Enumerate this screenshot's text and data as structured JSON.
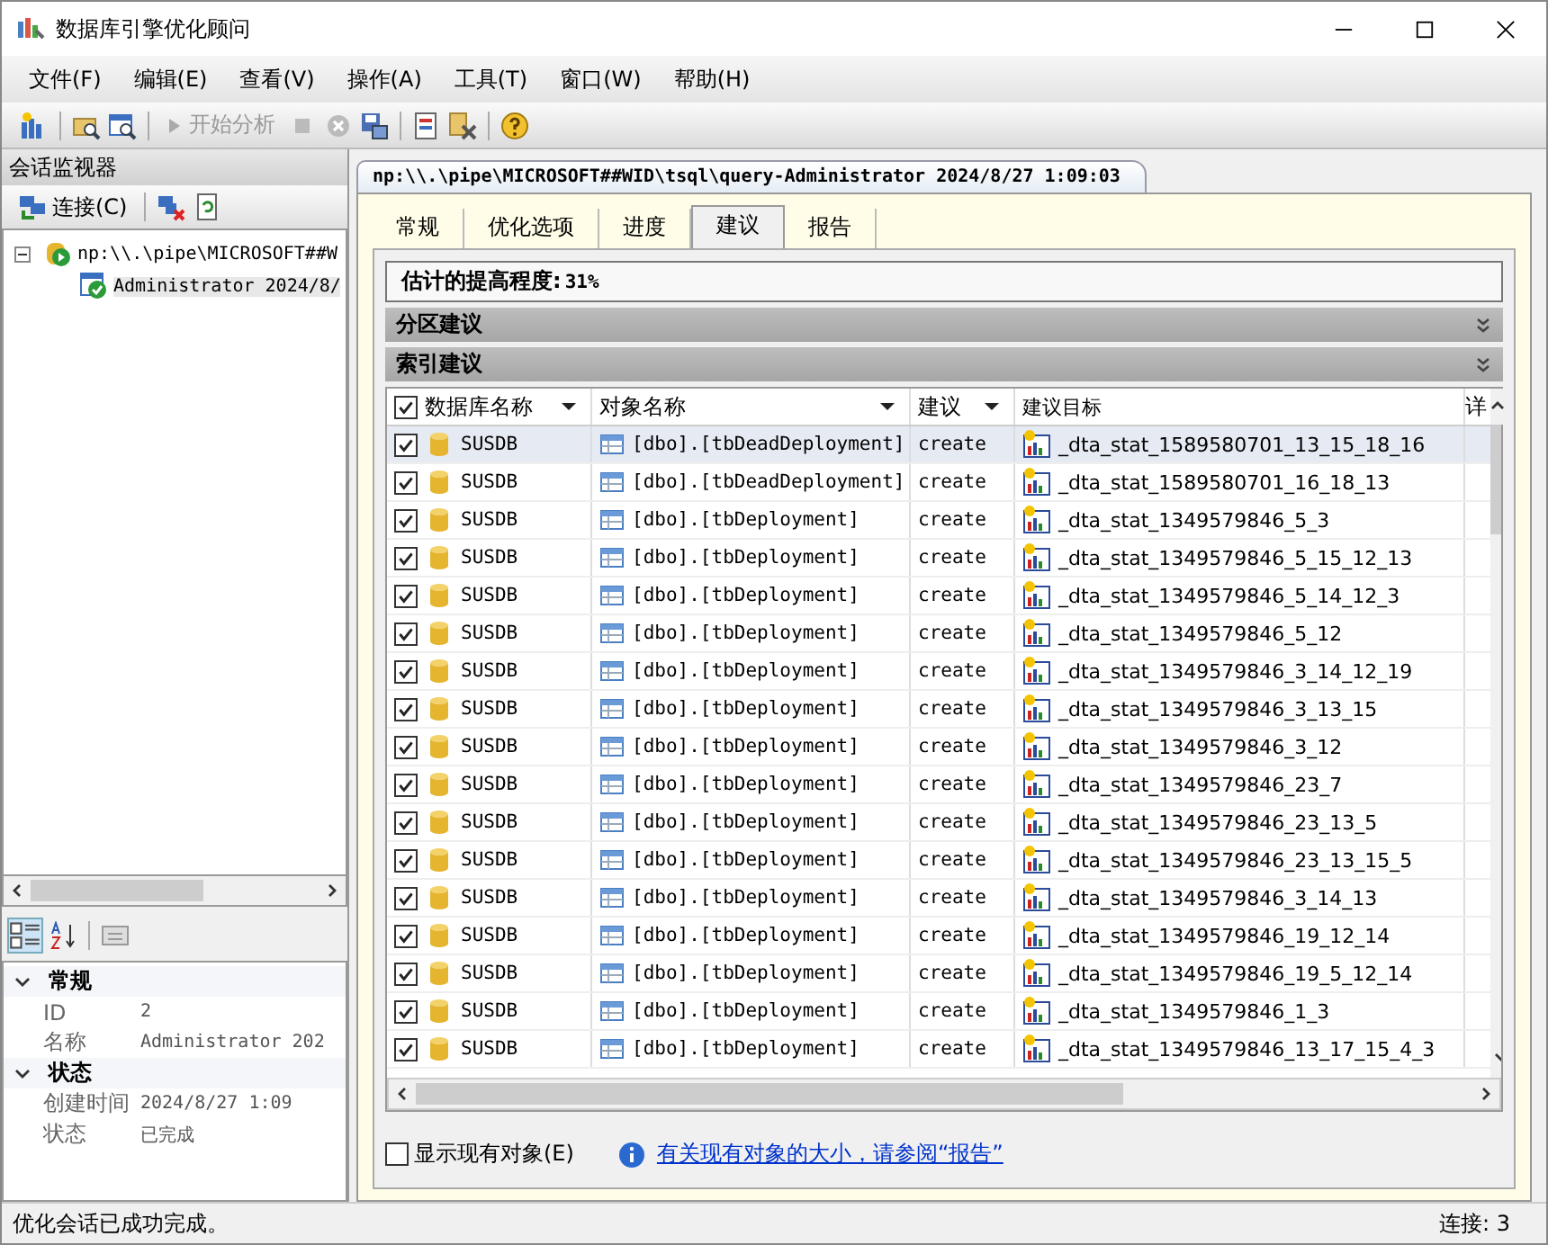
{
  "window": {
    "title": "数据库引擎优化顾问"
  },
  "menu": [
    "文件(F)",
    "编辑(E)",
    "查看(V)",
    "操作(A)",
    "工具(T)",
    "窗口(W)",
    "帮助(H)"
  ],
  "toolbar": {
    "start_button": {
      "label": "开始分析",
      "disabled": true
    }
  },
  "session_monitor": {
    "title": "会话监视器",
    "connect_button": "连接(C)",
    "tree": [
      {
        "label": "np:\\\\.\\pipe\\MICROSOFT##W",
        "expanded": true,
        "children": [
          {
            "label": "Administrator 2024/8/"
          }
        ]
      }
    ],
    "properties": [
      {
        "category": "常规",
        "expanded": true,
        "items": [
          {
            "name": "ID",
            "value": "2"
          },
          {
            "name": "名称",
            "value": "Administrator 202"
          }
        ]
      },
      {
        "category": "状态",
        "expanded": true,
        "items": [
          {
            "name": "创建时间",
            "value": "2024/8/27 1:09"
          },
          {
            "name": "状态",
            "value": "已完成"
          }
        ]
      }
    ]
  },
  "document_tab": "np:\\\\.\\pipe\\MICROSOFT##WID\\tsql\\query-Administrator 2024/8/27 1:09:03",
  "tabs": [
    {
      "label": "常规",
      "selected": false
    },
    {
      "label": "优化选项",
      "selected": false
    },
    {
      "label": "进度",
      "selected": false
    },
    {
      "label": "建议",
      "selected": true
    },
    {
      "label": "报告",
      "selected": false
    }
  ],
  "improvement": {
    "label": "估计的提高程度:",
    "value": "31%"
  },
  "sections": [
    "分区建议",
    "索引建议"
  ],
  "table": {
    "all_checked": true,
    "columns": [
      "数据库名称",
      "对象名称",
      "建议",
      "建议目标",
      "详"
    ],
    "rows": [
      {
        "checked": true,
        "selected": true,
        "database": "SUSDB",
        "object": "[dbo].[tbDeadDeployment]",
        "action": "create",
        "target": "_dta_stat_1589580701_13_15_18_16"
      },
      {
        "checked": true,
        "selected": false,
        "database": "SUSDB",
        "object": "[dbo].[tbDeadDeployment]",
        "action": "create",
        "target": "_dta_stat_1589580701_16_18_13"
      },
      {
        "checked": true,
        "selected": false,
        "database": "SUSDB",
        "object": "[dbo].[tbDeployment]",
        "action": "create",
        "target": "_dta_stat_1349579846_5_3"
      },
      {
        "checked": true,
        "selected": false,
        "database": "SUSDB",
        "object": "[dbo].[tbDeployment]",
        "action": "create",
        "target": "_dta_stat_1349579846_5_15_12_13"
      },
      {
        "checked": true,
        "selected": false,
        "database": "SUSDB",
        "object": "[dbo].[tbDeployment]",
        "action": "create",
        "target": "_dta_stat_1349579846_5_14_12_3"
      },
      {
        "checked": true,
        "selected": false,
        "database": "SUSDB",
        "object": "[dbo].[tbDeployment]",
        "action": "create",
        "target": "_dta_stat_1349579846_5_12"
      },
      {
        "checked": true,
        "selected": false,
        "database": "SUSDB",
        "object": "[dbo].[tbDeployment]",
        "action": "create",
        "target": "_dta_stat_1349579846_3_14_12_19"
      },
      {
        "checked": true,
        "selected": false,
        "database": "SUSDB",
        "object": "[dbo].[tbDeployment]",
        "action": "create",
        "target": "_dta_stat_1349579846_3_13_15"
      },
      {
        "checked": true,
        "selected": false,
        "database": "SUSDB",
        "object": "[dbo].[tbDeployment]",
        "action": "create",
        "target": "_dta_stat_1349579846_3_12"
      },
      {
        "checked": true,
        "selected": false,
        "database": "SUSDB",
        "object": "[dbo].[tbDeployment]",
        "action": "create",
        "target": "_dta_stat_1349579846_23_7"
      },
      {
        "checked": true,
        "selected": false,
        "database": "SUSDB",
        "object": "[dbo].[tbDeployment]",
        "action": "create",
        "target": "_dta_stat_1349579846_23_13_5"
      },
      {
        "checked": true,
        "selected": false,
        "database": "SUSDB",
        "object": "[dbo].[tbDeployment]",
        "action": "create",
        "target": "_dta_stat_1349579846_23_13_15_5"
      },
      {
        "checked": true,
        "selected": false,
        "database": "SUSDB",
        "object": "[dbo].[tbDeployment]",
        "action": "create",
        "target": "_dta_stat_1349579846_3_14_13"
      },
      {
        "checked": true,
        "selected": false,
        "database": "SUSDB",
        "object": "[dbo].[tbDeployment]",
        "action": "create",
        "target": "_dta_stat_1349579846_19_12_14"
      },
      {
        "checked": true,
        "selected": false,
        "database": "SUSDB",
        "object": "[dbo].[tbDeployment]",
        "action": "create",
        "target": "_dta_stat_1349579846_19_5_12_14"
      },
      {
        "checked": true,
        "selected": false,
        "database": "SUSDB",
        "object": "[dbo].[tbDeployment]",
        "action": "create",
        "target": "_dta_stat_1349579846_1_3"
      },
      {
        "checked": true,
        "selected": false,
        "database": "SUSDB",
        "object": "[dbo].[tbDeployment]",
        "action": "create",
        "target": "_dta_stat_1349579846_13_17_15_4_3"
      }
    ]
  },
  "show_existing": {
    "label": "显示现有对象(E)",
    "checked": false
  },
  "report_link": "有关现有对象的大小，请参阅“报告”",
  "status_bar": {
    "message": "优化会话已成功完成。",
    "connections": "连接: 3"
  }
}
